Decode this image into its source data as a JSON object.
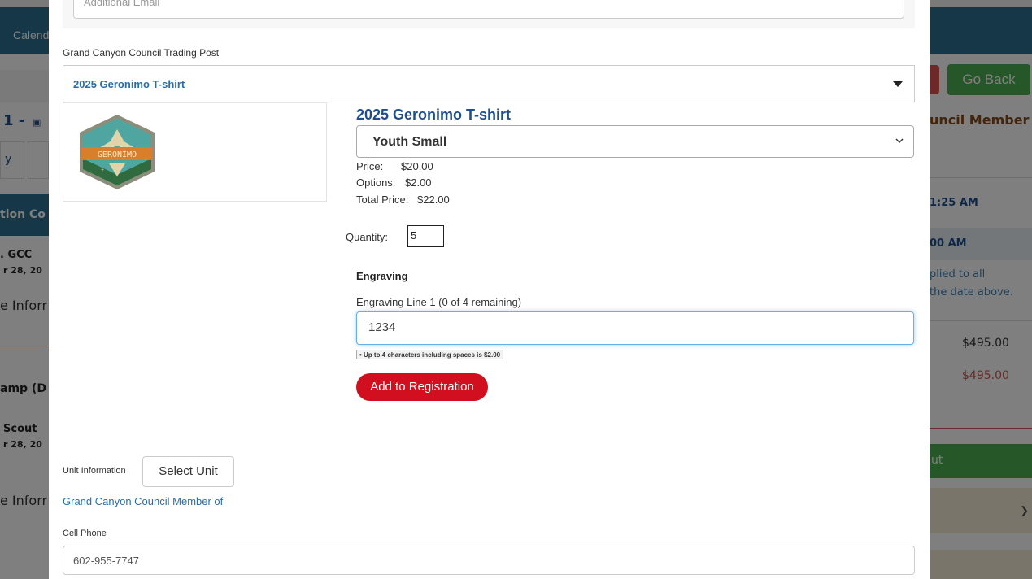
{
  "background": {
    "nav_item": "Calend",
    "go_back": "Go Back",
    "left_texts": [
      "1 -",
      "y",
      "tion Co",
      ". GCC",
      "r 28, 20",
      "e Inforr",
      "amp (D",
      "Scout",
      "r 28, 20",
      "e Inforr"
    ],
    "right_texts": [
      "uncil Member",
      "1:25 AM",
      "00 AM",
      "plied to all",
      "the date above.",
      "$495.00",
      "$495.00",
      "ut"
    ]
  },
  "modal": {
    "email_placeholder": "Additional Email",
    "trading_post_label": "Grand Canyon Council Trading Post",
    "product_select_value": "2025 Geronimo T-shirt",
    "logo_text": "GERONIMO",
    "product": {
      "title": "2025 Geronimo T-shirt",
      "size": "Youth Small",
      "price_label": "Price:",
      "price_value": "$20.00",
      "options_label": "Options:",
      "options_value": "$2.00",
      "total_label": "Total Price:",
      "total_value": "$22.00",
      "quantity_label": "Quantity:",
      "quantity_value": "5"
    },
    "engraving": {
      "title": "Engraving",
      "line_label": "Engraving Line 1 (0 of 4 remaining)",
      "line_value": "1234",
      "hint": "• Up to 4 characters including spaces is $2.00"
    },
    "add_button": "Add to Registration",
    "unit_label": "Unit Information",
    "select_unit_button": "Select Unit",
    "member_link": "Grand Canyon Council Member of",
    "cell_label": "Cell Phone",
    "cell_value": "602-955-7747"
  },
  "colors": {
    "accent_blue": "#2a6da7",
    "title_blue": "#1e4e8c",
    "button_red": "#d20f1f",
    "nav_teal": "#2d6e8e",
    "go_back_green": "#4caf50"
  }
}
